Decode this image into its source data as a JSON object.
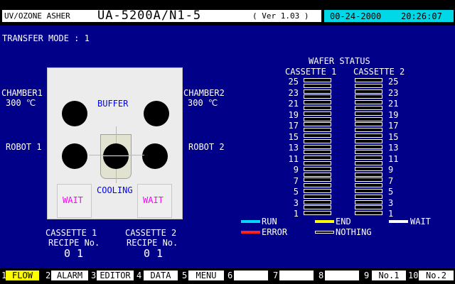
{
  "header": {
    "small_left": "UV/OZONE ASHER",
    "model": "UA-5200A/N1-5",
    "version": "( Ver 1.03 )",
    "date": "00-24-2000",
    "time": "20:26:07"
  },
  "transfer_mode": "TRANSFER MODE : 1",
  "chamber1": {
    "name": "CHAMBER1",
    "temp": "300 ℃"
  },
  "chamber2": {
    "name": "CHAMBER2",
    "temp": "300 ℃"
  },
  "robot1": "ROBOT 1",
  "robot2": "ROBOT 2",
  "diagram": {
    "buffer": "BUFFER",
    "cooling": "COOLING",
    "wait_left": "WAIT",
    "wait_right": "WAIT"
  },
  "cassette_recipes": [
    {
      "title": "CASSETTE 1",
      "recipe_label": "RECIPE No.",
      "recipe": "0 1"
    },
    {
      "title": "CASSETTE 2",
      "recipe_label": "RECIPE No.",
      "recipe": "0 1"
    }
  ],
  "wafer_status": {
    "title": "WAFER STATUS",
    "cassette1": "CASSETTE 1",
    "cassette2": "CASSETTE 2",
    "left_numbers": [
      "25",
      "23",
      "21",
      "19",
      "17",
      "15",
      "13",
      "11",
      "9",
      "7",
      "5",
      "3",
      "1"
    ],
    "right_numbers": [
      "25",
      "23",
      "21",
      "19",
      "17",
      "15",
      "13",
      "11",
      "9",
      "7",
      "5",
      "3",
      "1"
    ]
  },
  "legend": [
    {
      "label": "RUN",
      "color": "#00d8ff"
    },
    {
      "label": "END",
      "color": "#ffff00"
    },
    {
      "label": "WAIT",
      "color": "#ffffff"
    },
    {
      "label": "ERROR",
      "color": "#ff2020"
    },
    {
      "label": "NOTHING",
      "color": "#000000"
    }
  ],
  "footer": {
    "keys": [
      {
        "num": "1",
        "label": "FLOW"
      },
      {
        "num": "2",
        "label": "ALARM"
      },
      {
        "num": "3",
        "label": "EDITOR"
      },
      {
        "num": "4",
        "label": "DATA"
      },
      {
        "num": "5",
        "label": "MENU"
      },
      {
        "num": "6",
        "label": ""
      },
      {
        "num": "7",
        "label": ""
      },
      {
        "num": "8",
        "label": ""
      },
      {
        "num": "9",
        "label": "No.1"
      },
      {
        "num": "10",
        "label": "No.2"
      }
    ]
  }
}
